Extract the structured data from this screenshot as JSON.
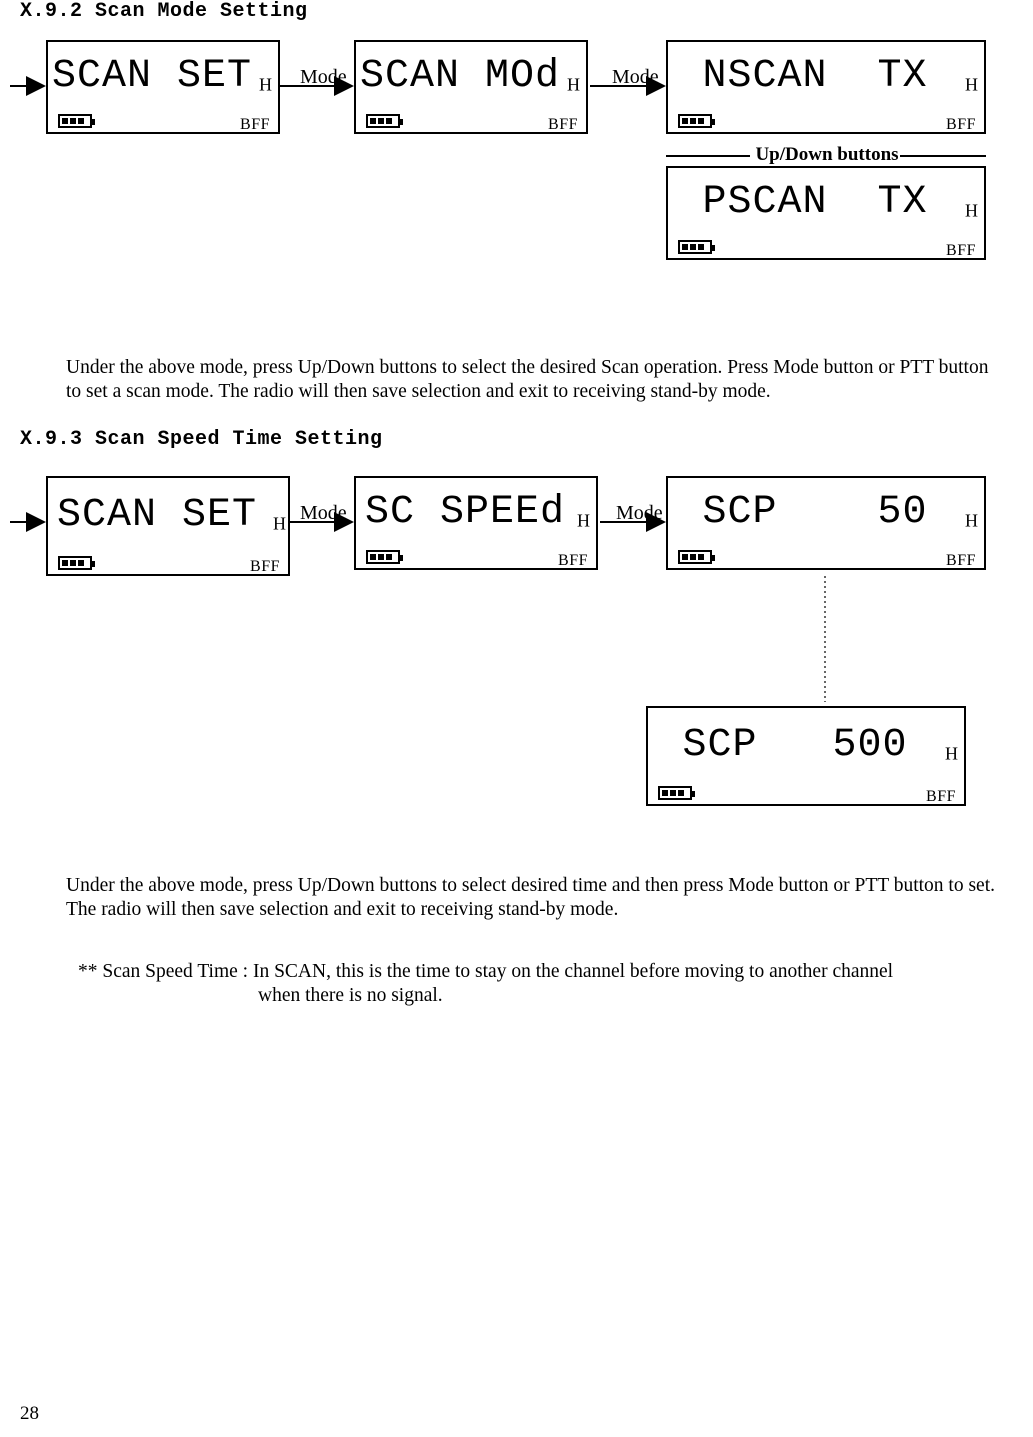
{
  "sections": {
    "s1": {
      "title": "X.9.2 Scan Mode Setting"
    },
    "s2": {
      "title": "X.9.3 Scan Speed Time Setting"
    }
  },
  "labels": {
    "mode": "Mode",
    "updown": "Up/Down buttons",
    "H": "H",
    "BFF": "BFF"
  },
  "lcd": {
    "flow1": {
      "box1": "SCAN SET",
      "box2": "SCAN MOd",
      "box3a": "NSCAN  TX",
      "box3b": "PSCAN  TX"
    },
    "flow2": {
      "box1": "SCAN SET",
      "box2": "SC SPEEd",
      "box3a": "SCP    50",
      "box3b": "SCP   500"
    }
  },
  "paragraphs": {
    "p1": "Under the above mode, press Up/Down buttons to select the desired Scan operation. Press Mode button or PTT button to set a scan mode. The radio will then save selection and exit to receiving stand-by mode.",
    "p2": "Under the above mode, press Up/Down buttons to select desired time and then press Mode button or PTT button to set. The radio will then save selection and exit to receiving stand-by mode.",
    "p3_line1": "** Scan Speed Time : In SCAN, this is the time to stay on the channel before moving to another channel",
    "p3_line2": "when there is no signal."
  },
  "page_number": "28"
}
